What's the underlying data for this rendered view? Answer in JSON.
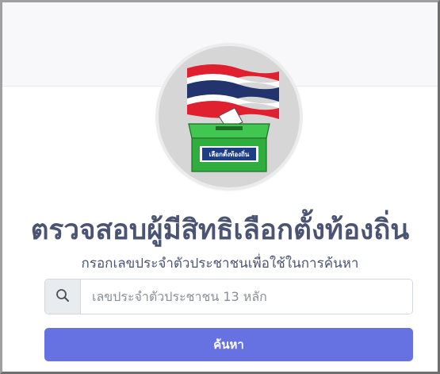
{
  "logo": {
    "box_label": "เลือกตั้งท้องถิ่น",
    "colors": {
      "red": "#e0202e",
      "white": "#ffffff",
      "blue": "#23336e",
      "box_green": "#2fae3e",
      "box_label_bg": "#1b3e86"
    }
  },
  "page": {
    "title": "ตรวจสอบผู้มีสิทธิเลือกตั้งท้องถิ่น",
    "subtitle": "กรอกเลขประจำตัวประชาชนเพื่อใช้ในการค้นหา"
  },
  "search": {
    "icon": "search-icon",
    "placeholder": "เลขประจำตัวประชาชน 13 หลัก",
    "value": ""
  },
  "submit": {
    "label": "ค้นหา",
    "color": "#6672e2"
  }
}
